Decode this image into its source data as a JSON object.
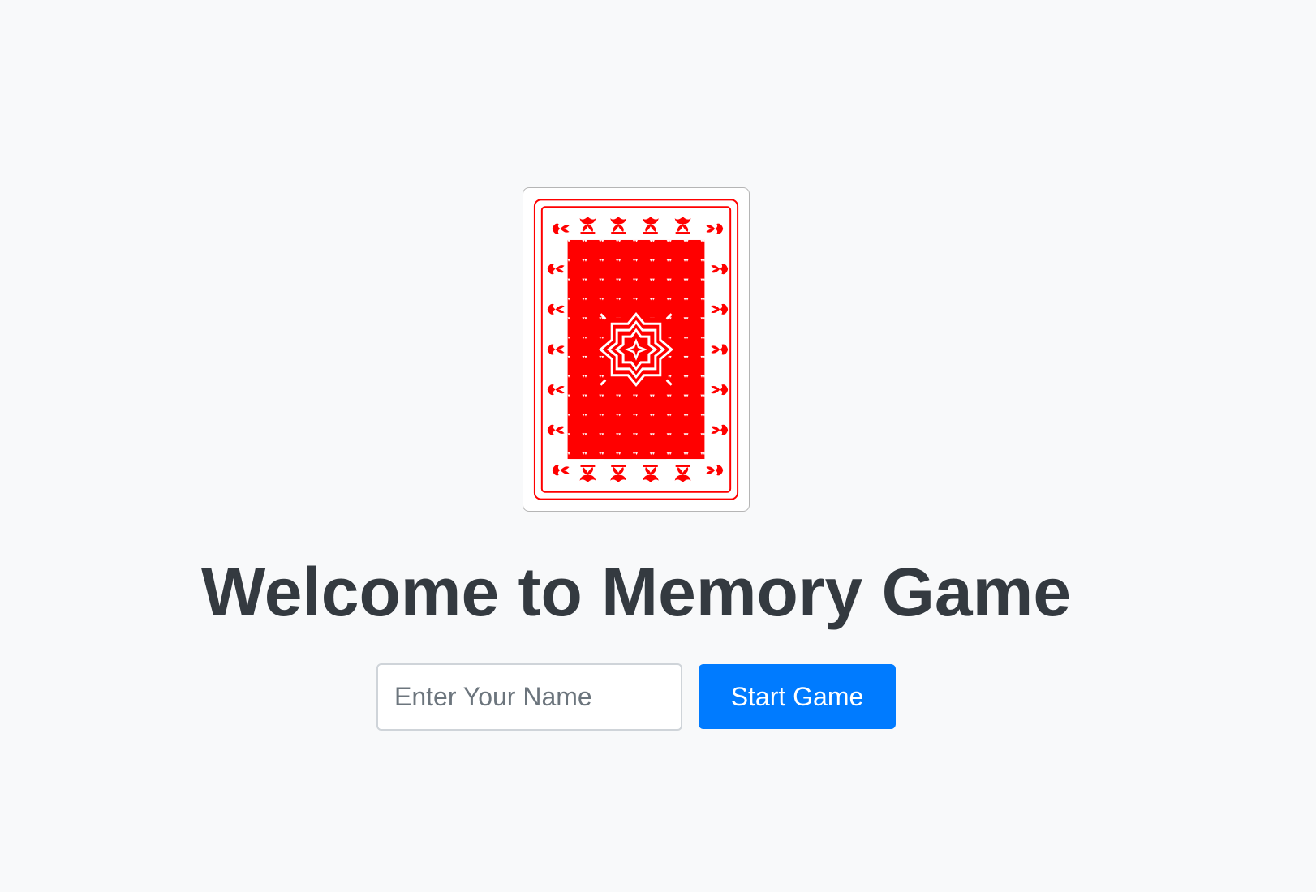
{
  "game": {
    "title": "Welcome to Memory Game"
  },
  "card_back": {
    "icon": "card-back-image",
    "pattern_color": "#ff0000"
  },
  "start_form": {
    "name_placeholder": "Enter Your Name",
    "name_value": "",
    "start_label": "Start Game"
  },
  "colors": {
    "background": "#f8f9fa",
    "title": "#343a40",
    "button": "#007bff",
    "button_text": "#ffffff"
  }
}
